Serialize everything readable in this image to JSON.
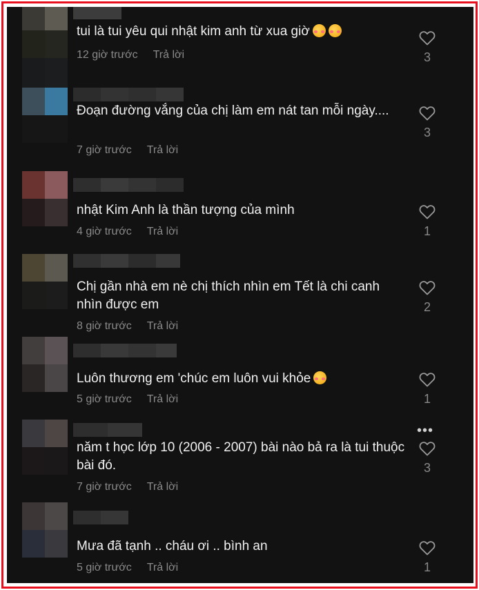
{
  "comments": [
    {
      "text": "tui là tui yêu qui nhật kim anh từ xua giờ",
      "emoji": [
        "smiling-face-with-hearts",
        "smiling-face-with-hearts"
      ],
      "time": "12 giờ trước",
      "reply": "Trả lời",
      "likes": "3"
    },
    {
      "text": "Đoạn đường vắng của chị làm em nát tan mỗi ngày....",
      "time": "7 giờ trước",
      "reply": "Trả lời",
      "likes": "3"
    },
    {
      "text": "nhật Kim Anh là thần tượng của mình",
      "time": "4 giờ trước",
      "reply": "Trả lời",
      "likes": "1"
    },
    {
      "text": "Chị gần nhà em nè chị thích nhìn em Tết là chi canh nhìn được em",
      "time": "8 giờ trước",
      "reply": "Trả lời",
      "likes": "2"
    },
    {
      "text": "Luôn thương em 'chúc em luôn vui khỏe",
      "emoji": [
        "smiling-face-with-hearts"
      ],
      "time": "5 giờ trước",
      "reply": "Trả lời",
      "likes": "1"
    },
    {
      "text": "năm t học lớp 10 (2006 - 2007) bài nào bả ra là tui thuộc bài đó.",
      "time": "7 giờ trước",
      "reply": "Trả lời",
      "likes": "3"
    },
    {
      "text": "Mưa đã tạnh .. cháu ơi .. bình an",
      "time": "5 giờ trước",
      "reply": "Trả lời",
      "likes": "1"
    }
  ],
  "more_menu": "•••",
  "icons": {
    "like": "heart-outline-icon",
    "more": "more-horizontal-icon"
  },
  "colors": {
    "frame_border": "#e8101e",
    "background": "#121212",
    "text": "#f1f1f1",
    "muted": "#8a8a8a"
  }
}
